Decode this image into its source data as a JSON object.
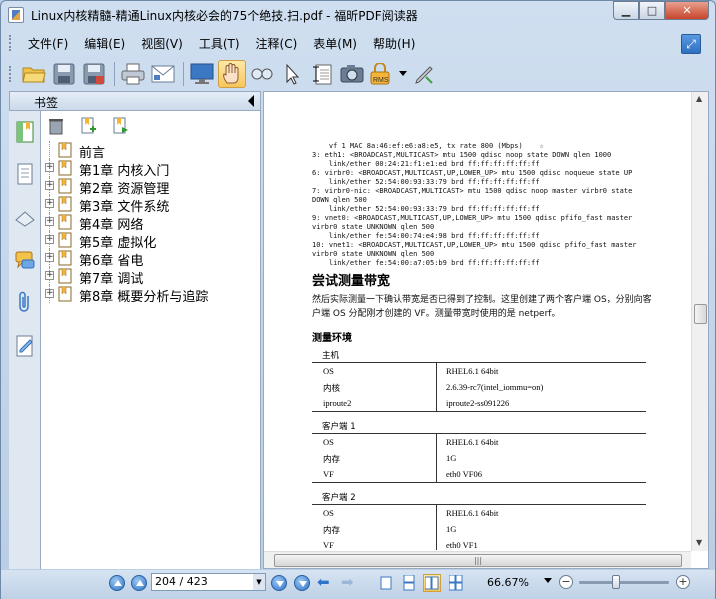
{
  "window": {
    "title": "Linux内核精髓-精通Linux内核必会的75个绝技.扫.pdf - 福昕PDF阅读器"
  },
  "menu": {
    "items": [
      "文件(F)",
      "编辑(E)",
      "视图(V)",
      "工具(T)",
      "注释(C)",
      "表单(M)",
      "帮助(H)"
    ]
  },
  "toolbar": {
    "icons": [
      "open-folder-icon",
      "save-icon",
      "save-as-icon",
      "print-icon",
      "email-icon",
      "fullscreen-icon",
      "hand-tool-icon",
      "snapshot-zoom-icon",
      "select-arrow-icon",
      "text-select-icon",
      "camera-icon",
      "rms-lock-icon",
      "sign-pen-icon"
    ],
    "active": "hand-tool-icon"
  },
  "sidebar": {
    "title": "书签",
    "tabs": [
      "bookmarks-tab-icon",
      "pages-tab-icon",
      "layers-tab-icon",
      "comments-tab-icon",
      "attachments-tab-icon",
      "signatures-tab-icon"
    ],
    "bookmarks": [
      {
        "label": "前言",
        "expandable": false
      },
      {
        "label": "第1章 内核入门",
        "expandable": true
      },
      {
        "label": "第2章 资源管理",
        "expandable": true
      },
      {
        "label": "第3章 文件系统",
        "expandable": true
      },
      {
        "label": "第4章 网络",
        "expandable": true
      },
      {
        "label": "第5章 虚拟化",
        "expandable": true
      },
      {
        "label": "第6章 省电",
        "expandable": true
      },
      {
        "label": "第7章 调试",
        "expandable": true
      },
      {
        "label": "第8章 概要分析与追踪",
        "expandable": true
      }
    ]
  },
  "document": {
    "code_lines": [
      "    vf 1 MAC 8a:46:ef:e6:a8:e5, tx rate 800 (Mbps)    ☆",
      "3: eth1: <BROADCAST,MULTICAST> mtu 1500 qdisc noop state DOWN qlen 1000",
      "    link/ether 00:24:21:f1:e1:ed brd ff:ff:ff:ff:ff:ff",
      "6: virbr0: <BROADCAST,MULTICAST,UP,LOWER_UP> mtu 1500 qdisc noqueue state UP",
      "    link/ether 52:54:00:93:33:79 brd ff:ff:ff:ff:ff:ff",
      "7: virbr0-nic: <BROADCAST,MULTICAST> mtu 1500 qdisc noop master virbr0 state",
      "DOWN qlen 500",
      "    link/ether 52:54:00:93:33:79 brd ff:ff:ff:ff:ff:ff",
      "9: vnet0: <BROADCAST,MULTICAST,UP,LOWER_UP> mtu 1500 qdisc pfifo_fast master",
      "virbr0 state UNKNOWN qlen 500",
      "    link/ether fe:54:00:74:e4:98 brd ff:ff:ff:ff:ff:ff",
      "10: vnet1: <BROADCAST,MULTICAST,UP,LOWER_UP> mtu 1500 qdisc pfifo_fast master",
      "virbr0 state UNKNOWN qlen 500",
      "    link/ether fe:54:00:a7:05:b9 brd ff:ff:ff:ff:ff:ff"
    ],
    "heading": "尝试测量带宽",
    "paragraph": "然后实际测量一下确认带宽是否已得到了控制。这里创建了两个客户端 OS，分别向客户端 OS 分配刚才创建的 VF。测量带宽时使用的是 netperf。",
    "subheading": "测量环境",
    "sections": [
      {
        "name": "主机",
        "rows": [
          [
            "OS",
            "RHEL6.1 64bit"
          ],
          [
            "内核",
            "2.6.39-rc7(intel_iommu=on)"
          ],
          [
            "iproute2",
            "iproute2-ss091226"
          ]
        ]
      },
      {
        "name": "客户端 1",
        "rows": [
          [
            "OS",
            "RHEL6.1 64bit"
          ],
          [
            "内存",
            "1G"
          ],
          [
            "VF",
            "eth0 VF06"
          ]
        ]
      },
      {
        "name": "客户端 2",
        "rows": [
          [
            "OS",
            "RHEL6.1 64bit"
          ],
          [
            "内存",
            "1G"
          ],
          [
            "VF",
            "eth0 VF1"
          ]
        ]
      }
    ]
  },
  "status": {
    "page_display": "204 / 423",
    "zoom": "66.67%",
    "zoom_level": 0.4
  }
}
